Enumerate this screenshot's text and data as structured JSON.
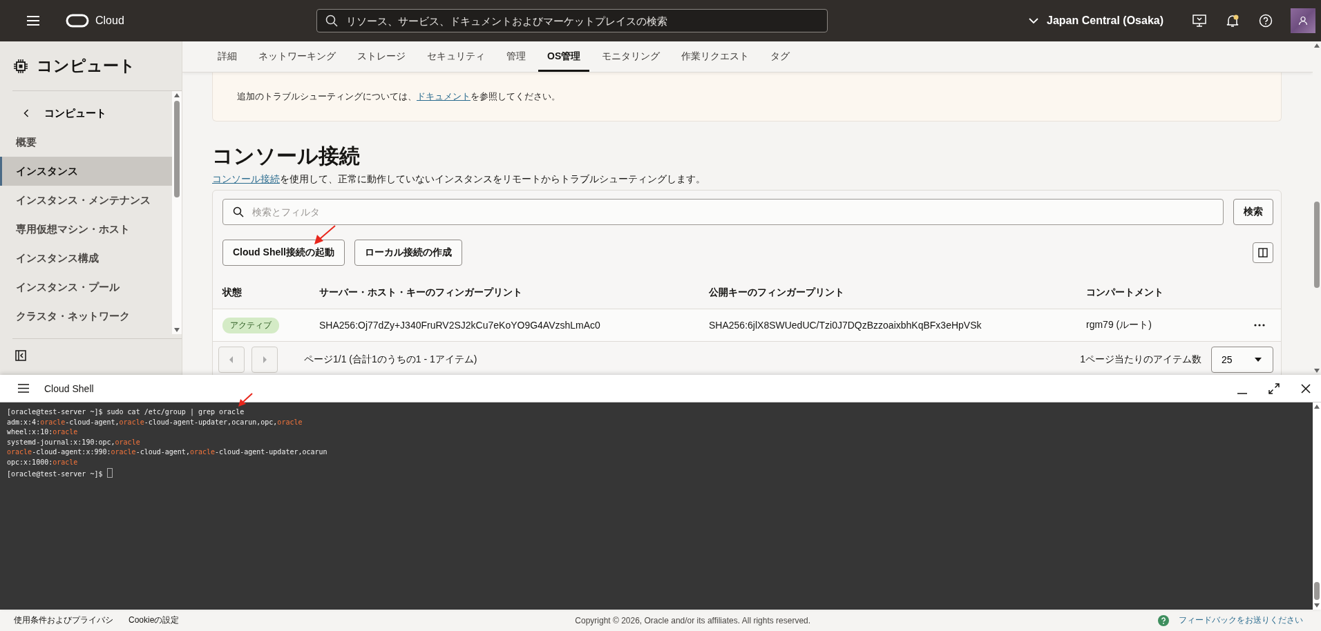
{
  "header": {
    "logo_text": "Cloud",
    "search": {
      "placeholder": "リソース、サービス、ドキュメントおよびマーケットプレイスの検索"
    },
    "region": "Japan Central (Osaka)",
    "has_unread": true
  },
  "sidebar": {
    "title": "コンピュート",
    "back_label": "コンピュート",
    "items": [
      {
        "label": "概要",
        "selected": false
      },
      {
        "label": "インスタンス",
        "selected": true
      },
      {
        "label": "インスタンス・メンテナンス",
        "selected": false
      },
      {
        "label": "専用仮想マシン・ホスト",
        "selected": false
      },
      {
        "label": "インスタンス構成",
        "selected": false
      },
      {
        "label": "インスタンス・プール",
        "selected": false
      },
      {
        "label": "クラスタ・ネットワーク",
        "selected": false
      }
    ]
  },
  "tabs": [
    {
      "label": "詳細",
      "selected": false
    },
    {
      "label": "ネットワーキング",
      "selected": false
    },
    {
      "label": "ストレージ",
      "selected": false
    },
    {
      "label": "セキュリティ",
      "selected": false
    },
    {
      "label": "管理",
      "selected": false
    },
    {
      "label": "OS管理",
      "selected": true
    },
    {
      "label": "モニタリング",
      "selected": false
    },
    {
      "label": "作業リクエスト",
      "selected": false
    },
    {
      "label": "タグ",
      "selected": false
    }
  ],
  "banner": {
    "text_before": "追加のトラブルシューティングについては、",
    "link": "ドキュメント",
    "text_after": "を参照してください。"
  },
  "section": {
    "title": "コンソール接続",
    "description_link": "コンソール接続",
    "description": "を使用して、正常に動作していないインスタンスをリモートからトラブルシューティングします。"
  },
  "search": {
    "placeholder": "検索とフィルタ",
    "button": "検索"
  },
  "actions": [
    "Cloud Shell接続の起動",
    "ローカル接続の作成"
  ],
  "table": {
    "columns": [
      "状態",
      "サーバー・ホスト・キーのフィンガープリント",
      "公開キーのフィンガープリント",
      "コンパートメント"
    ],
    "rows": [
      {
        "status": "アクティブ",
        "server_fingerprint": "SHA256:Oj77dZy+J340FruRV2SJ2kCu7eKoYO9G4AVzshLmAc0",
        "public_fingerprint": "SHA256:6jlX8SWUedUC/Tzi0J7DQzBzzoaixbhKqBFx3eHpVSk",
        "compartment": "rgm79 (ルート)"
      }
    ]
  },
  "pagination": {
    "summary": "ページ1/1 (合計1のうちの1 - 1アイテム)",
    "per_page_label": "1ページ当たりのアイテム数",
    "per_page": "25"
  },
  "shell": {
    "title": "Cloud Shell",
    "cursor": true,
    "lines": [
      [
        {
          "text": "[oracle@test-server ~]$ sudo cat /etc/group | grep oracle",
          "match": false
        }
      ],
      [
        {
          "text": "adm:x:4:",
          "match": false
        },
        {
          "text": "oracle",
          "match": true
        },
        {
          "text": "-cloud-agent,",
          "match": false
        },
        {
          "text": "oracle",
          "match": true
        },
        {
          "text": "-cloud-agent-updater,ocarun,opc,",
          "match": false
        },
        {
          "text": "oracle",
          "match": true
        }
      ],
      [
        {
          "text": "wheel:x:10:",
          "match": false
        },
        {
          "text": "oracle",
          "match": true
        }
      ],
      [
        {
          "text": "systemd-journal:x:190:opc,",
          "match": false
        },
        {
          "text": "oracle",
          "match": true
        }
      ],
      [
        {
          "text": "oracle",
          "match": true
        },
        {
          "text": "-cloud-agent:x:990:",
          "match": false
        },
        {
          "text": "oracle",
          "match": true
        },
        {
          "text": "-cloud-agent,",
          "match": false
        },
        {
          "text": "oracle",
          "match": true
        },
        {
          "text": "-cloud-agent-updater,ocarun",
          "match": false
        }
      ],
      [
        {
          "text": "opc:x:1000:",
          "match": false
        },
        {
          "text": "oracle",
          "match": true
        }
      ],
      [
        {
          "text": "[oracle@test-server ~]$ ",
          "match": false
        }
      ]
    ]
  },
  "footer": {
    "links": [
      "使用条件およびプライバシ",
      "Cookieの設定"
    ],
    "copyright": "Copyright © 2026, Oracle and/or its affiliates. All rights reserved.",
    "feedback": "フィードバックをお送りください"
  }
}
